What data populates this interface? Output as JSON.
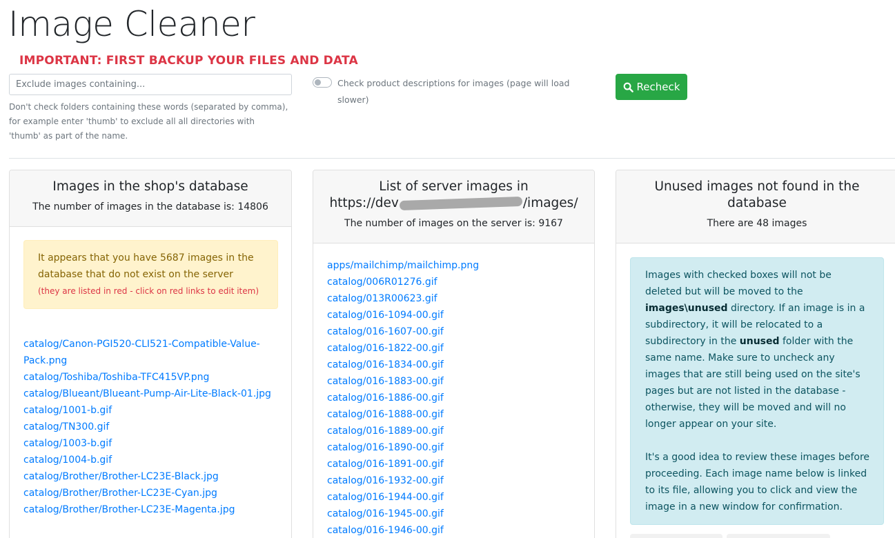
{
  "page": {
    "title": "Image Cleaner",
    "warning": "IMPORTANT: FIRST BACKUP YOUR FILES AND DATA"
  },
  "controls": {
    "exclude_placeholder": "Exclude images containing...",
    "exclude_value": "",
    "exclude_help": "Don't check folders containing these words (separated by comma), for example enter 'thumb' to exclude all all directories with 'thumb' as part of the name.",
    "toggle_label": "Check product descriptions for images (page will load slower)",
    "toggle_on": false,
    "recheck_label": "Recheck",
    "recheck_icon": "search-icon",
    "accent_color": "#28a745"
  },
  "database_card": {
    "title": "Images in the shop's database",
    "subtitle": "The number of images in the database is: 14806",
    "alert_text": "It appears that you have 5687 images in the database that do not exist on the server",
    "alert_note": "(they are listed in red - click on red links to edit item)",
    "images": [
      "catalog/Canon-PGI520-CLI521-Compatible-Value-Pack.png",
      "catalog/Toshiba/Toshiba-TFC415VP.png",
      "catalog/Blueant/Blueant-Pump-Air-Lite-Black-01.jpg",
      "catalog/1001-b.gif",
      "catalog/TN300.gif",
      "catalog/1003-b.gif",
      "catalog/1004-b.gif",
      "catalog/Brother/Brother-LC23E-Black.jpg",
      "catalog/Brother/Brother-LC23E-Cyan.jpg",
      "catalog/Brother/Brother-LC23E-Magenta.jpg"
    ]
  },
  "server_card": {
    "title_before": "List of server images in",
    "title_prefix": "https://dev",
    "title_suffix": "/images/",
    "subtitle": "The number of images on the server is: 9167",
    "images": [
      "apps/mailchimp/mailchimp.png",
      "catalog/006R01276.gif",
      "catalog/013R00623.gif",
      "catalog/016-1094-00.gif",
      "catalog/016-1607-00.gif",
      "catalog/016-1822-00.gif",
      "catalog/016-1834-00.gif",
      "catalog/016-1883-00.gif",
      "catalog/016-1886-00.gif",
      "catalog/016-1888-00.gif",
      "catalog/016-1889-00.gif",
      "catalog/016-1890-00.gif",
      "catalog/016-1891-00.gif",
      "catalog/016-1932-00.gif",
      "catalog/016-1944-00.gif",
      "catalog/016-1945-00.gif",
      "catalog/016-1946-00.gif"
    ]
  },
  "unused_card": {
    "title": "Unused images not found in the database",
    "subtitle": "There are 48 images",
    "info_1a": "Images with checked boxes will not be deleted but will be moved to the ",
    "info_1b": "images\\unused",
    "info_1c": " directory. If an image is in a subdirectory, it will be relocated to a subdirectory in the ",
    "info_1d": "unused",
    "info_1e": " folder with the same name. Make sure to uncheck any images that are still being used on the site's pages but are not listed in the database - otherwise, they will be moved and will no longer appear on your site.",
    "info_2": "It's a good idea to review these images before proceeding. Each image name below is linked to its file, allowing you to click and view the image in a new window for confirmation."
  }
}
